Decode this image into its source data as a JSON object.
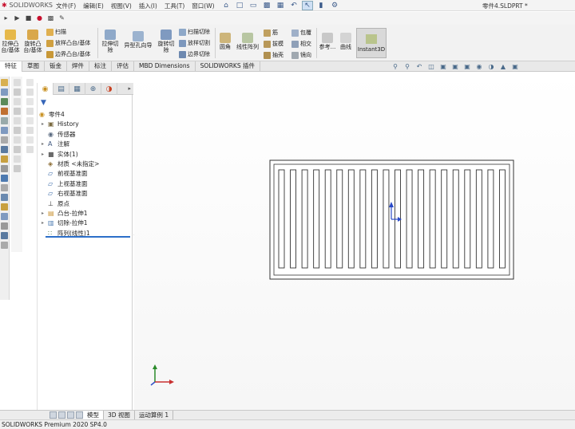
{
  "app": {
    "logo_text": "SOLIDWORKS",
    "document_title": "零件4.SLDPRT *"
  },
  "menu": [
    "文件(F)",
    "编辑(E)",
    "视图(V)",
    "插入(I)",
    "工具(T)",
    "窗口(W)"
  ],
  "ribbon": {
    "extrude_boss": "拉伸凸\n台/基体",
    "revolve_boss": "旋转凸\n台/基体",
    "sweep": "扫描",
    "loft_boss": "放样凸台/基体",
    "boundary_boss": "边界凸台/基体",
    "extrude_cut": "拉伸切\n除",
    "hole_wizard": "异型孔向导",
    "revolve_cut": "旋转切\n除",
    "swept_cut": "扫描切除",
    "lofted_cut": "放样切割",
    "boundary_cut": "边界切除",
    "fillet": "圆角",
    "linear_pattern": "线性阵列",
    "rib": "筋",
    "draft": "拔模",
    "shell": "抽壳",
    "wrap": "包覆",
    "intersect": "相交",
    "mirror": "镜向",
    "reference": "参考...",
    "curves": "曲线",
    "instant3d": "Instant3D"
  },
  "tabs": [
    "特征",
    "草图",
    "钣金",
    "焊件",
    "标注",
    "评估",
    "MBD Dimensions",
    "SOLIDWORKS 插件"
  ],
  "tree": {
    "root": "零件4",
    "items": [
      {
        "label": "History",
        "icon": "history-icon",
        "exp": true
      },
      {
        "label": "传感器",
        "icon": "sensor-icon",
        "exp": false
      },
      {
        "label": "注解",
        "icon": "annotation-icon",
        "exp": true
      },
      {
        "label": "实体(1)",
        "icon": "solid-body-icon",
        "exp": true
      },
      {
        "label": "材质 <未指定>",
        "icon": "material-icon",
        "exp": false
      },
      {
        "label": "前视基准面",
        "icon": "plane-icon",
        "exp": false
      },
      {
        "label": "上视基准面",
        "icon": "plane-icon",
        "exp": false
      },
      {
        "label": "右视基准面",
        "icon": "plane-icon",
        "exp": false
      },
      {
        "label": "原点",
        "icon": "origin-icon",
        "exp": false
      },
      {
        "label": "凸台-拉伸1",
        "icon": "boss-extrude-icon",
        "exp": true
      },
      {
        "label": "切除-拉伸1",
        "icon": "cut-extrude-icon",
        "exp": true
      },
      {
        "label": "阵列(线性)1",
        "icon": "linear-pattern-icon",
        "exp": false
      }
    ]
  },
  "bottom_tabs": [
    "模型",
    "3D 视图",
    "运动算例 1"
  ],
  "status_bar": "SOLIDWORKS Premium 2020 SP4.0",
  "colors": {
    "accent": "#2c6fc9",
    "brand": "#c8102e",
    "slot_outline": "#333333"
  },
  "part": {
    "slot_count": 20
  }
}
